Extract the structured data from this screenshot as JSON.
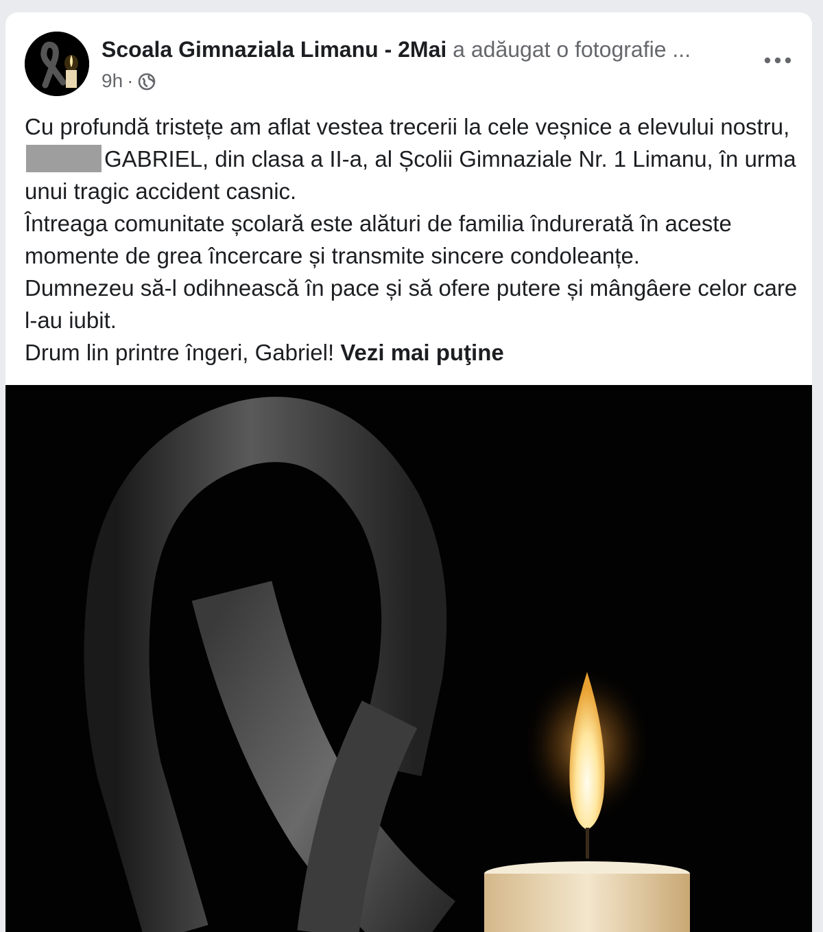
{
  "post": {
    "author": "Scoala Gimnaziala Limanu - 2Mai",
    "action": "a adăugat o fotografie ...",
    "time": "9h",
    "separator": "·",
    "privacy_icon": "globe-icon",
    "more_icon": "more-options-icon",
    "avatar_icon": "black-ribbon-candle-avatar",
    "body": {
      "line1": "Cu profundă tristețe am aflat vestea trecerii la cele veșnice a elevului nostru,",
      "line1_after": "GABRIEL, din clasa a II-a, al Școlii Gimnaziale Nr. 1 Limanu, în urma unui tragic accident casnic.",
      "line2": "Întreaga comunitate școlară este alături de familia îndurerată în aceste momente de grea încercare și transmite sincere condoleanțe.",
      "line3": "Dumnezeu să-l odihnească în pace și să ofere putere și mângâere celor care l-au iubit.",
      "line4": "Drum lin printre îngeri, Gabriel!",
      "see_less": "Vezi mai puţine"
    },
    "photo": {
      "subject": "black mourning ribbon with lit candle",
      "background_color": "#020202"
    }
  }
}
